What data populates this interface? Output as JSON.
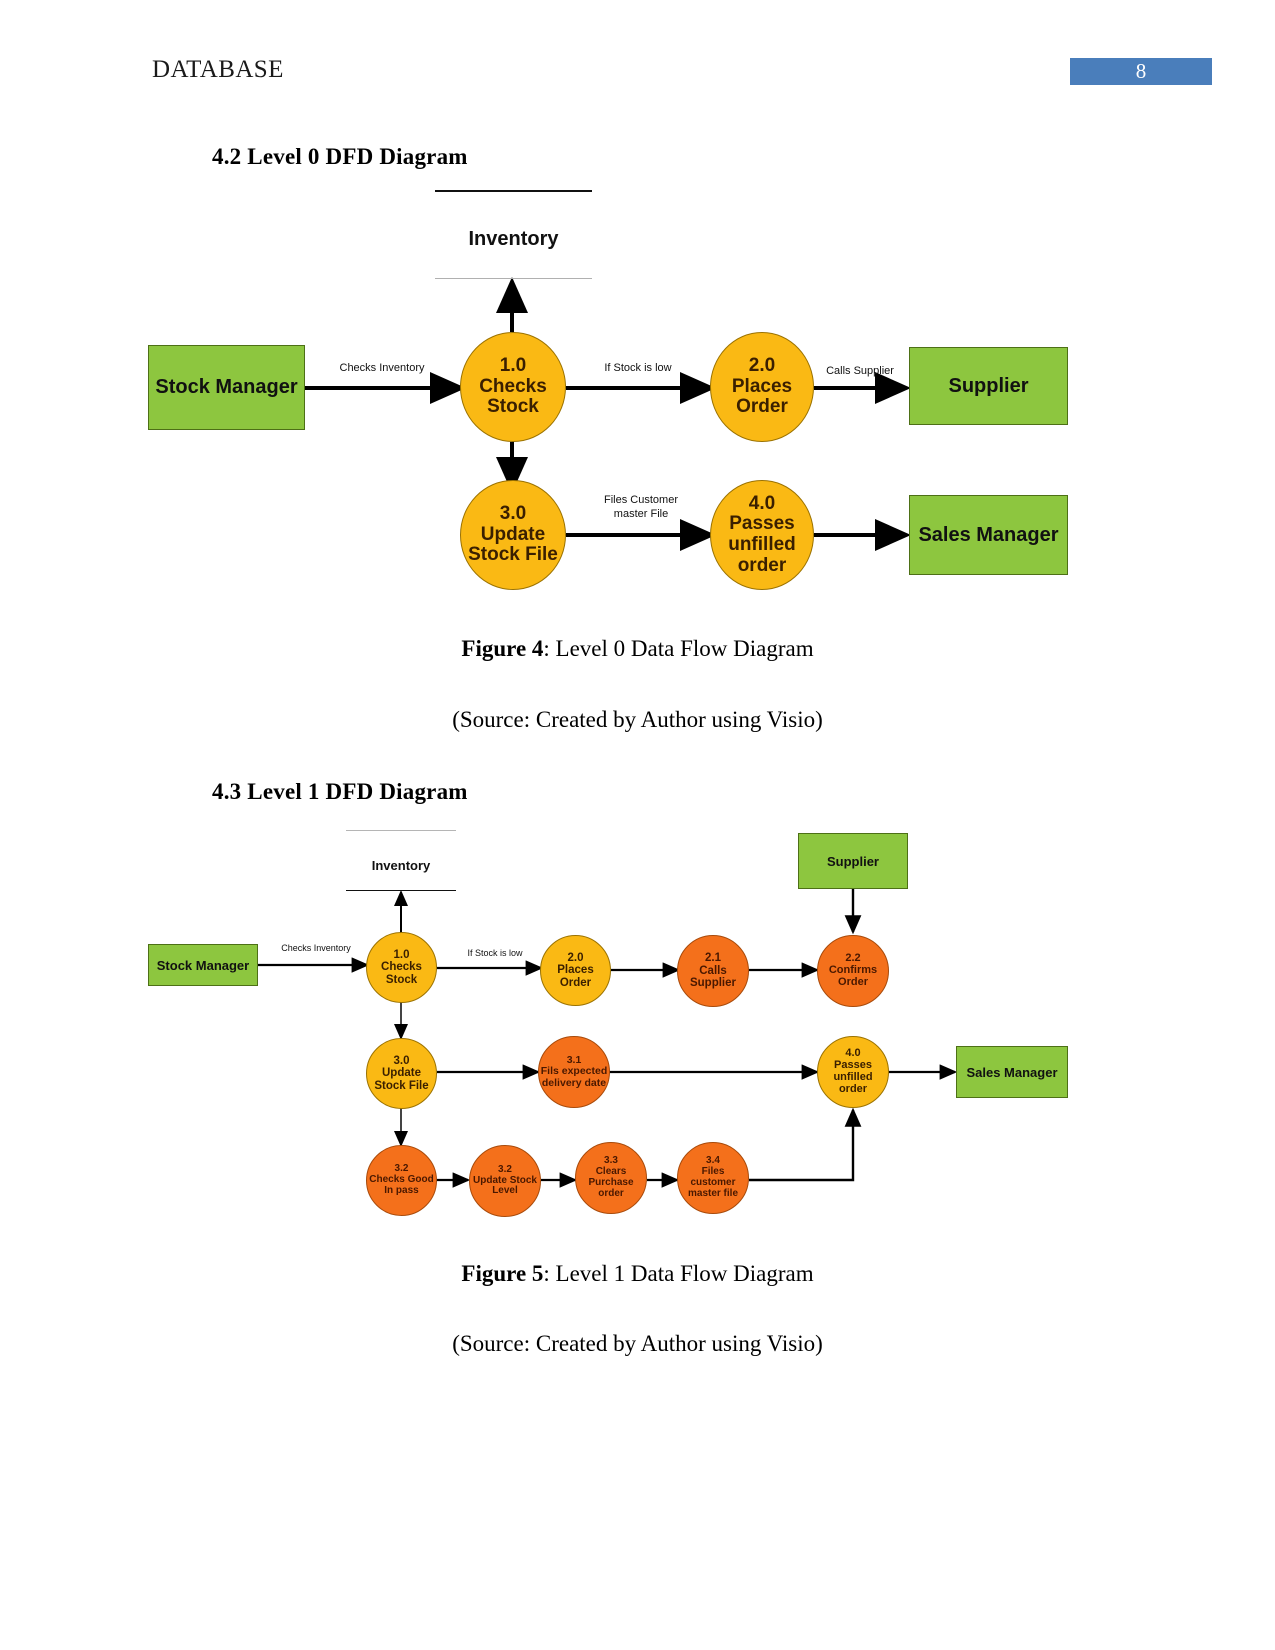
{
  "header": {
    "doc_title": "DATABASE",
    "page_number": "8",
    "badge_color": "#4A7EBB"
  },
  "sections": [
    {
      "id": "4.2",
      "heading": "4.2 Level 0 DFD Diagram"
    },
    {
      "id": "4.3",
      "heading": "4.3 Level 1 DFD Diagram"
    }
  ],
  "captions": {
    "figure4_bold": "Figure 4",
    "figure4_rest": ": Level 0 Data Flow Diagram",
    "figure4_source": "(Source: Created by Author using Visio)",
    "figure5_bold": "Figure 5",
    "figure5_rest": ": Level 1 Data Flow Diagram",
    "figure5_source": "(Source: Created by Author using Visio)"
  },
  "palette": {
    "entity_green": "#8DC63F",
    "process_amber": "#FAB914",
    "process_orange": "#F4701B",
    "arrow_black": "#000000"
  },
  "level0": {
    "datastore": {
      "label": "Inventory"
    },
    "entities": [
      {
        "key": "stock_manager",
        "label": "Stock Manager"
      },
      {
        "key": "supplier",
        "label": "Supplier"
      },
      {
        "key": "sales_manager",
        "label": "Sales Manager"
      }
    ],
    "processes": [
      {
        "key": "p1",
        "number": "1.0",
        "name": "Checks\nStock",
        "line1": "1.0",
        "line2": "Checks",
        "line3": "Stock",
        "color": "amber"
      },
      {
        "key": "p2",
        "number": "2.0",
        "name": "Places\nOrder",
        "line1": "2.0",
        "line2": "Places",
        "line3": "Order",
        "color": "amber"
      },
      {
        "key": "p3",
        "number": "3.0",
        "name": "Update\nStock File",
        "line1": "3.0",
        "line2": "Update",
        "line3": "Stock File",
        "color": "amber"
      },
      {
        "key": "p4",
        "number": "4.0",
        "name": "Passes\nunfilled\norder",
        "line1": "4.0",
        "line2": "Passes",
        "line3": "unfilled",
        "line4": "order",
        "color": "amber"
      }
    ],
    "flow_labels": {
      "checks_inventory": "Checks Inventory",
      "if_stock_low": "If Stock is low",
      "calls_supplier": "Calls Supplier",
      "files_customer_master": "Files Customer\nmaster File"
    }
  },
  "level1": {
    "datastore": {
      "label": "Inventory"
    },
    "entities": [
      {
        "key": "stock_manager",
        "label": "Stock Manager"
      },
      {
        "key": "supplier",
        "label": "Supplier"
      },
      {
        "key": "sales_manager",
        "label": "Sales Manager"
      }
    ],
    "processes": [
      {
        "key": "p10",
        "line1": "1.0",
        "line2": "Checks",
        "line3": "Stock",
        "color": "amber"
      },
      {
        "key": "p20",
        "line1": "2.0",
        "line2": "Places",
        "line3": "Order",
        "color": "amber"
      },
      {
        "key": "p21",
        "line1": "2.1",
        "line2": "Calls",
        "line3": "Supplier",
        "color": "orange"
      },
      {
        "key": "p22",
        "line1": "2.2",
        "line2": "Confirms",
        "line3": "Order",
        "color": "orange"
      },
      {
        "key": "p30",
        "line1": "3.0",
        "line2": "Update",
        "line3": "Stock File",
        "color": "amber"
      },
      {
        "key": "p31",
        "line1": "3.1",
        "line2": "Fils expected",
        "line3": "delivery date",
        "color": "orange"
      },
      {
        "key": "p40",
        "line1": "4.0",
        "line2": "Passes",
        "line3": "unfilled",
        "line4": "order",
        "color": "amber"
      },
      {
        "key": "p32a",
        "line1": "3.2",
        "line2": "Checks Good",
        "line3": "In pass",
        "color": "orange"
      },
      {
        "key": "p32b",
        "line1": "3.2",
        "line2": "Update Stock",
        "line3": "Level",
        "color": "orange"
      },
      {
        "key": "p33",
        "line1": "3.3",
        "line2": "Clears",
        "line3": "Purchase",
        "line4": "order",
        "color": "orange"
      },
      {
        "key": "p34",
        "line1": "3.4",
        "line2": "Files",
        "line3": "customer",
        "line4": "master file",
        "color": "orange"
      }
    ],
    "flow_labels": {
      "checks_inventory": "Checks Inventory",
      "if_stock_low": "If Stock is low"
    }
  }
}
